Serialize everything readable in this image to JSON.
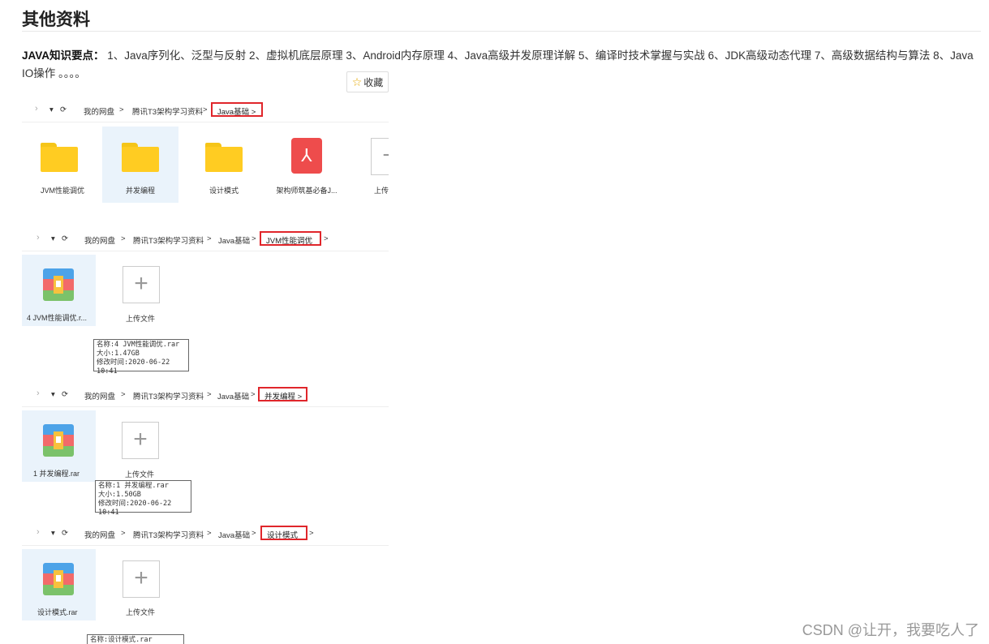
{
  "heading": "其他资料",
  "intro": {
    "label": "JAVA知识要点：",
    "text": "1、Java序列化、泛型与反射 2、虚拟机底层原理 3、Android内存原理 4、Java高级并发原理详解 5、编译时技术掌握与实战 6、JDK高级动态代理 7、高级数据结构与算法 8、Java IO操作 。。。。"
  },
  "favorite_button": {
    "label": "收藏",
    "icon": "star-icon"
  },
  "panel1": {
    "crumbs": [
      "我的网盘",
      "腾讯T3架构学习资料"
    ],
    "current": "Java基础",
    "items": [
      {
        "label": "JVM性能调优",
        "icon": "folder-icon"
      },
      {
        "label": "并发编程",
        "icon": "folder-icon"
      },
      {
        "label": "设计模式",
        "icon": "folder-icon"
      },
      {
        "label": "架构师筑基必备J...",
        "icon": "pdf-icon"
      },
      {
        "label": "上传",
        "icon": "upload-icon"
      }
    ]
  },
  "panel2": {
    "crumbs": [
      "我的网盘",
      "腾讯T3架构学习资料",
      "Java基础"
    ],
    "current": "JVM性能调优",
    "file": "4 JVM性能调优.r...",
    "upload": "上传文件",
    "tooltip": [
      "名称:4 JVM性能调优.rar",
      "大小:1.47GB",
      "修改时间:2020-06-22 10:41"
    ]
  },
  "panel3": {
    "crumbs": [
      "我的网盘",
      "腾讯T3架构学习资料",
      "Java基础"
    ],
    "current": "并发编程",
    "file": "1 并发编程.rar",
    "upload": "上传文件",
    "tooltip": [
      "名称:1 并发编程.rar",
      "大小:1.50GB",
      "修改时间:2020-06-22 10:41"
    ]
  },
  "panel4": {
    "crumbs": [
      "我的网盘",
      "腾讯T3架构学习资料",
      "Java基础"
    ],
    "current": "设计模式",
    "file": "设计模式.rar",
    "upload": "上传文件",
    "tooltip": [
      "名称:设计模式.rar"
    ]
  },
  "watermark": "CSDN @让开，我要吃人了"
}
